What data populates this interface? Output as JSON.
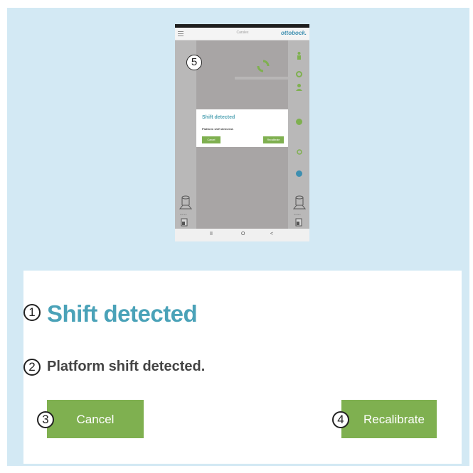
{
  "tablet": {
    "app_title": "Carslex",
    "brand": "ottobock.",
    "callout": "5",
    "dialog": {
      "title": "Shift detected",
      "message": "Platform shift detected.",
      "cancel_label": "Cancel",
      "recalibrate_label": "Recalibrate"
    },
    "left_readout": "0.0 Nm",
    "left_percent": "50 %",
    "right_readout": "0.0 Nm",
    "right_percent": "50 %",
    "nav": {
      "recent": "II",
      "home": "O",
      "back": "<"
    }
  },
  "dialog": {
    "title_marker": "1",
    "title": "Shift detected",
    "message_marker": "2",
    "message": "Platform shift detected.",
    "cancel_marker": "3",
    "cancel_label": "Cancel",
    "recalibrate_marker": "4",
    "recalibrate_label": "Recalibrate"
  },
  "colors": {
    "background": "#d3e9f4",
    "title": "#4aa2b8",
    "button": "#7fb050",
    "message": "#444444"
  }
}
